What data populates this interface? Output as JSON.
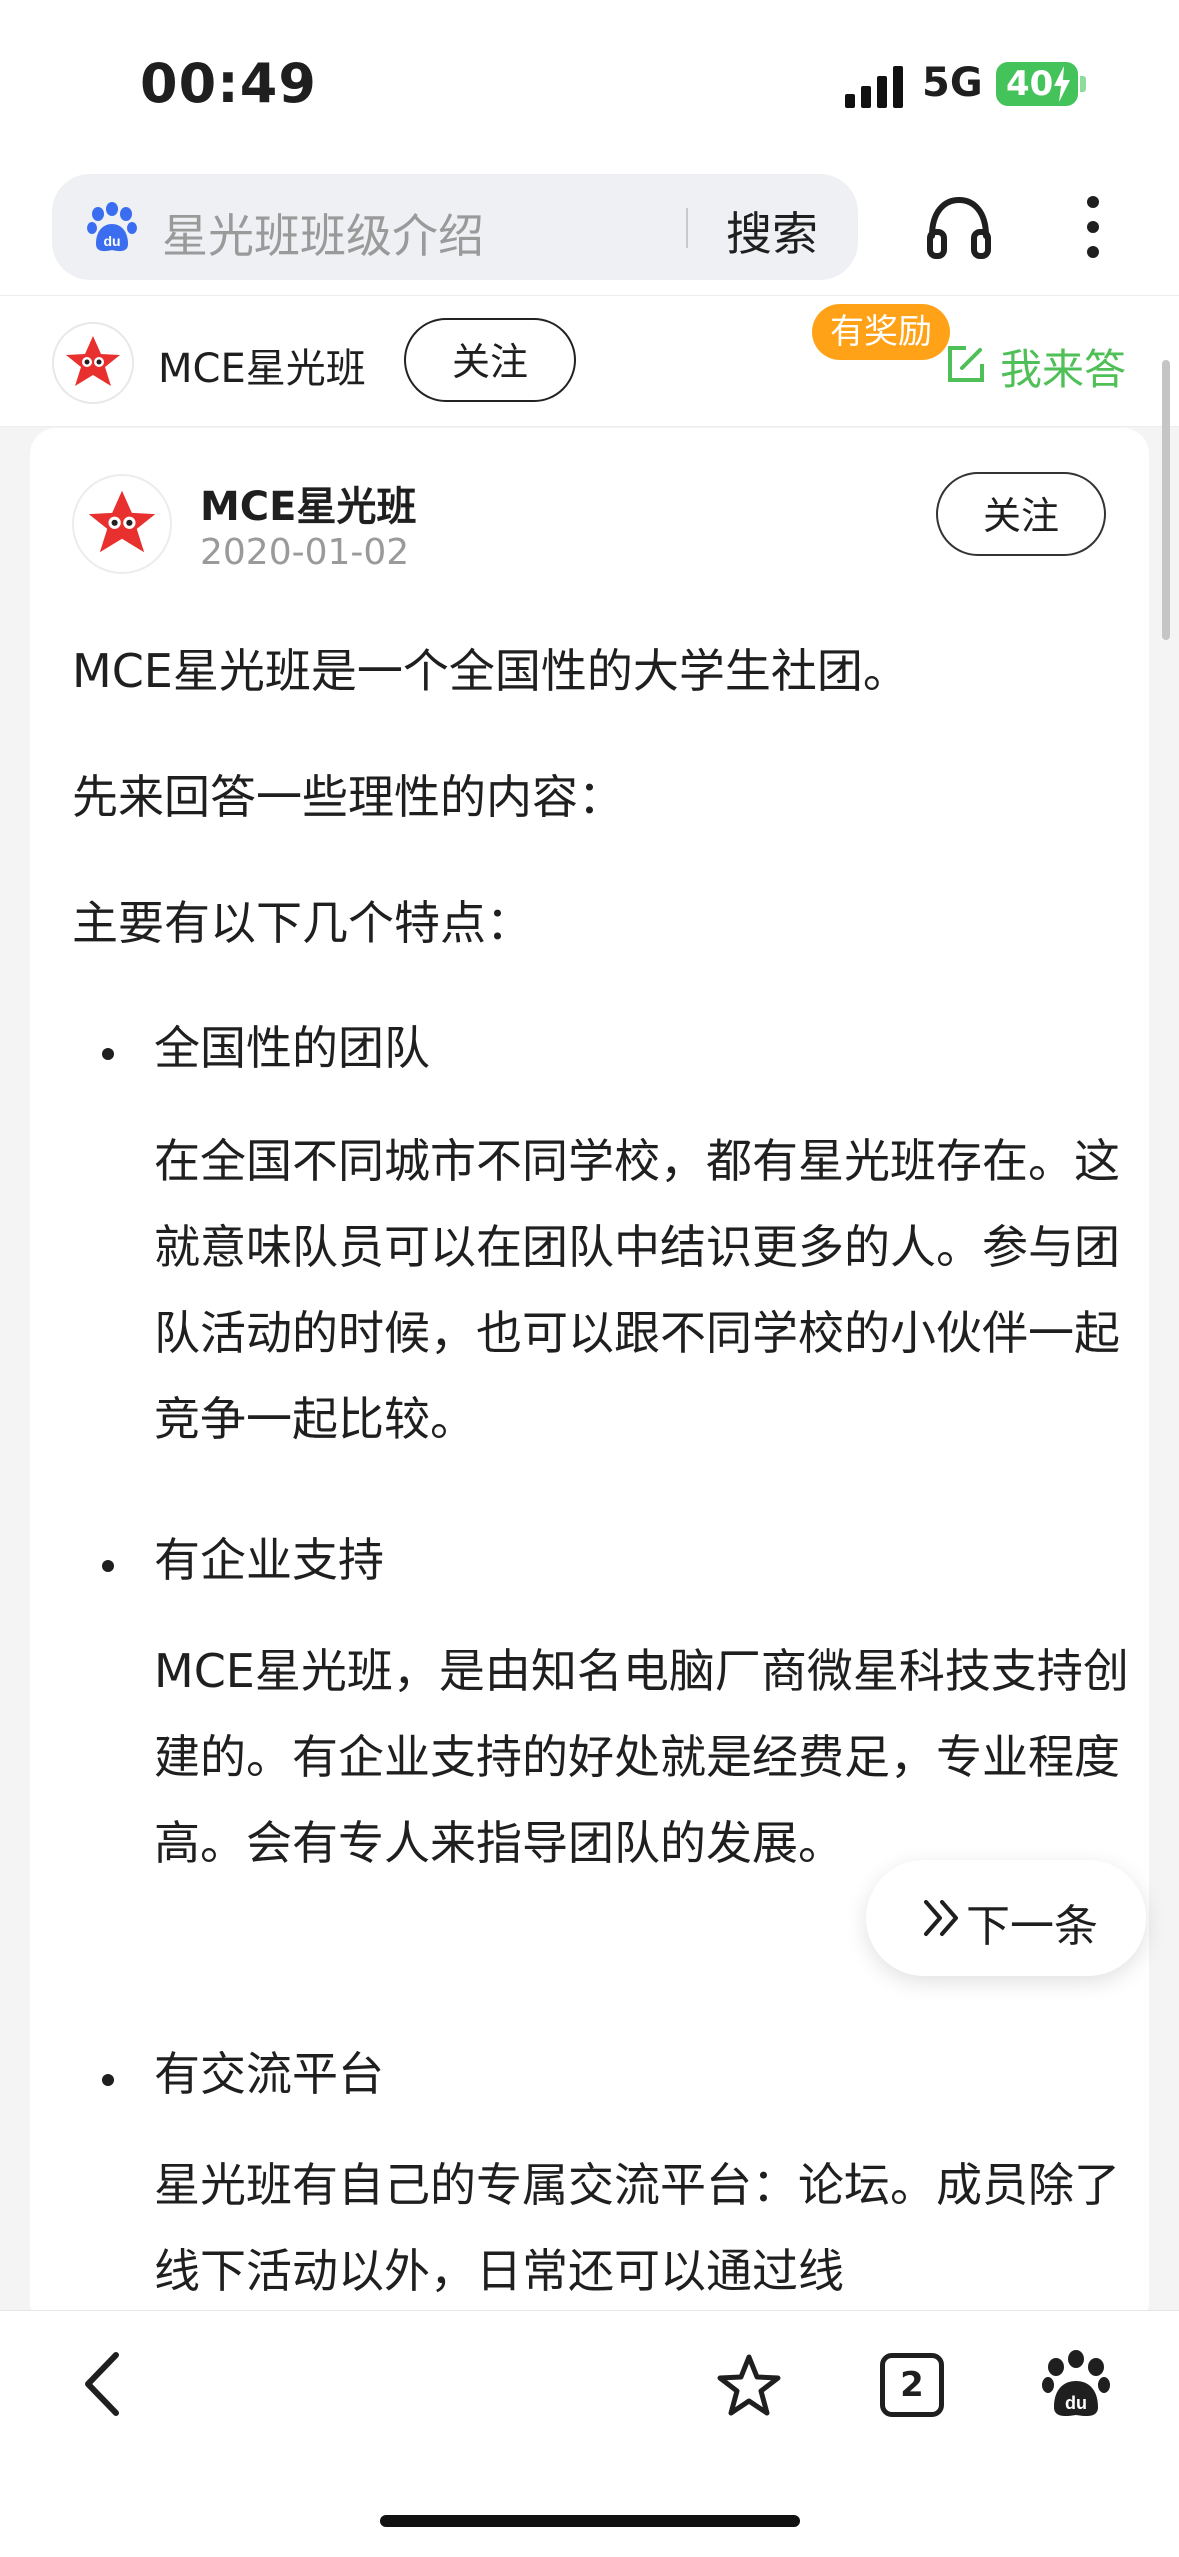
{
  "status_bar": {
    "time": "00:49",
    "network": "5G",
    "battery": "40"
  },
  "header": {
    "search_text": "星光班班级介绍",
    "search_button": "搜索"
  },
  "author_bar": {
    "name": "MCE星光班",
    "follow_label": "关注",
    "reward_badge": "有奖励",
    "answer_label": "我来答"
  },
  "card": {
    "author_name": "MCE星光班",
    "date": "2020-01-02",
    "follow_label": "关注",
    "paragraphs": [
      "MCE星光班是一个全国性的大学生社团。",
      "先来回答一些理性的内容：",
      "主要有以下几个特点："
    ],
    "bullets": [
      {
        "title": "全国性的团队",
        "body": "在全国不同城市不同学校，都有星光班存在。这就意味队员可以在团队中结识更多的人。参与团队活动的时候，也可以跟不同学校的小伙伴一起竞争一起比较。"
      },
      {
        "title": "有企业支持",
        "body": "MCE星光班，是由知名电脑厂商微星科技支持创建的。有企业支持的好处就是经费足，专业程度高。会有专人来指导团队的发展。"
      },
      {
        "title": "有交流平台",
        "body": "星光班有自己的专属交流平台：论坛。成员除了线下活动以外，日常还可以通过线"
      }
    ]
  },
  "next_button": {
    "label": "下一条"
  },
  "bottom_bar": {
    "tab_count": "2"
  }
}
